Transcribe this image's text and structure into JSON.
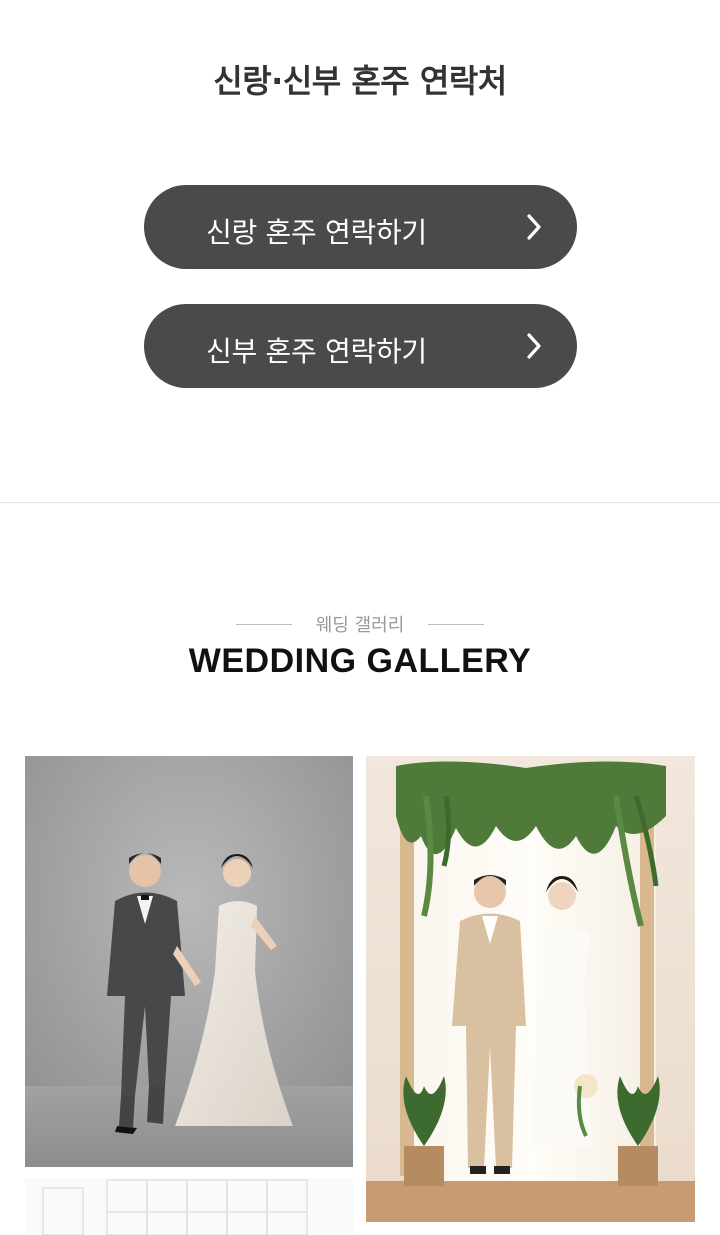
{
  "contact": {
    "title": "신랑·신부 혼주 연락처",
    "buttons": [
      {
        "label": "신랑 혼주 연락하기",
        "icon": "chevron-right-icon"
      },
      {
        "label": "신부 혼주 연락하기",
        "icon": "chevron-right-icon"
      }
    ]
  },
  "gallery": {
    "subtitle": "웨딩 갤러리",
    "title": "WEDDING GALLERY",
    "photos": [
      {
        "description": "couple-photo-gray-studio"
      },
      {
        "description": "couple-photo-floral-arch"
      },
      {
        "description": "white-interior-photo"
      }
    ]
  },
  "colors": {
    "button_bg": "#4a4a4a",
    "divider": "#e3e3e3"
  }
}
